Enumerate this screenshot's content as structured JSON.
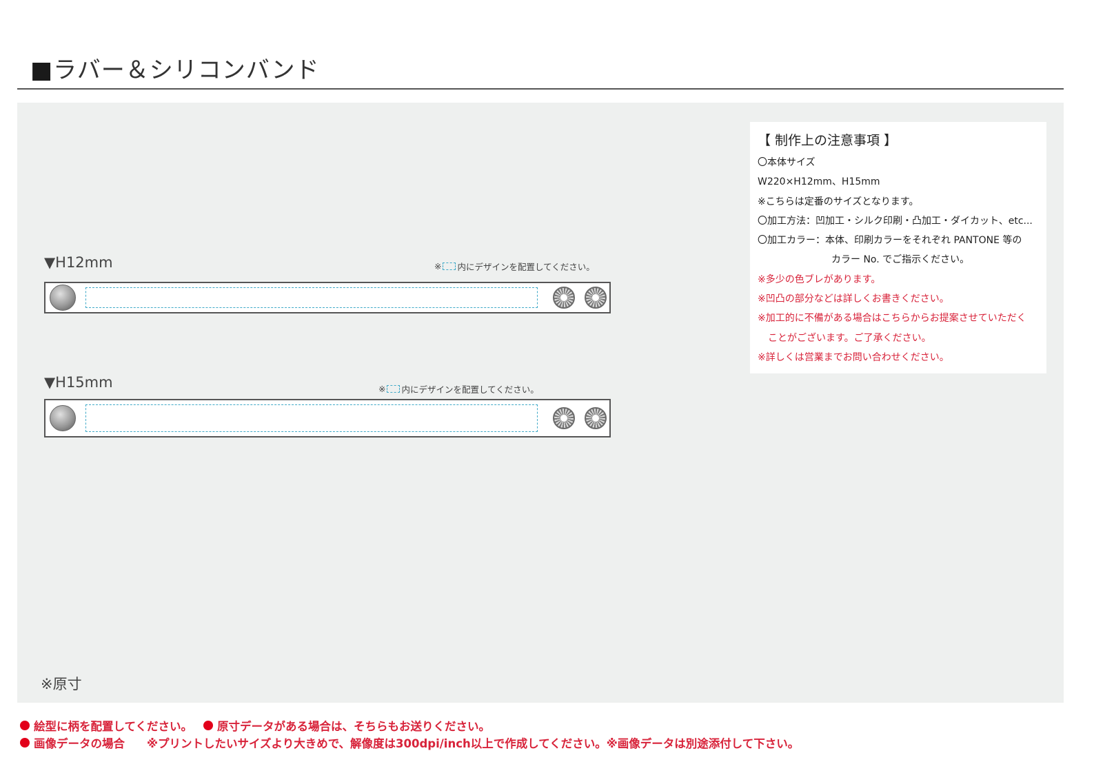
{
  "page": {
    "title_mark": "■",
    "title": "ラバー＆シリコンバンド"
  },
  "notes": {
    "heading": "【 制作上の注意事項 】",
    "lines": [
      "〇本体サイズ",
      "W220×H12mm、H15mm",
      "※こちらは定番のサイズとなります。",
      "〇加工方法：凹加工・シルク印刷・凸加工・ダイカット、etc...",
      "〇加工カラー：本体、印刷カラーをそれぞれ PANTONE 等の",
      "カラー No. でご指示ください。",
      "※多少の色ブレがあります。",
      "※凹凸の部分などは詳しくお書きください。",
      "※加工的に不備がある場合はこちらからお提案させていただく",
      "ことがございます。ご了承ください。",
      "※詳しくは営業までお問い合わせください。"
    ],
    "red_color": "#d8233a"
  },
  "bands": [
    {
      "label": "▼H12mm",
      "note_prefix": "※",
      "note_suffix": "内にデザインを配置してください。"
    },
    {
      "label": "▼H15mm",
      "note_prefix": "※",
      "note_suffix": "内にデザインを配置してください。"
    }
  ],
  "original_size": "※原寸",
  "footer": {
    "line1_a": "絵型に柄を配置してください。",
    "line1_b": "原寸データがある場合は、そちらもお送りください。",
    "line2_a": "画像データの場合",
    "line2_b": "※プリントしたいサイズより大きめで、解像度は300dpi/inch以上で作成してください。※画像データは別途添付して下さい。"
  },
  "colors": {
    "accent_red": "#e2001a",
    "guide_cyan": "#3fa9c8",
    "panel_bg": "#eef0ef"
  }
}
